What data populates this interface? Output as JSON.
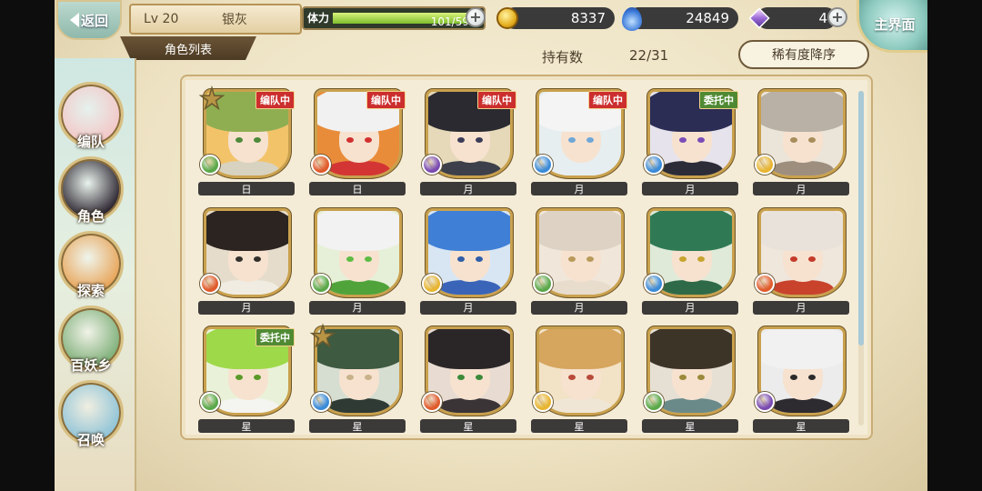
{
  "header": {
    "back_label": "返回",
    "level": "Lv 20",
    "player_name": "银灰",
    "stamina_label": "体力",
    "stamina_value": "101/59",
    "stamina_fraction": 1.0,
    "gold": "8337",
    "spirit": "24849",
    "gems": "4",
    "home_label": "主界面"
  },
  "section_title": "角色列表",
  "owned": {
    "label": "持有数",
    "value": "22/31"
  },
  "sort_label": "稀有度降序",
  "nav": [
    {
      "label": "编队",
      "icon": "formation-icon",
      "color": "#f2c8c8"
    },
    {
      "label": "角色",
      "icon": "character-icon",
      "color": "#2b2530"
    },
    {
      "label": "探索",
      "icon": "explore-icon",
      "color": "#e8a55a"
    },
    {
      "label": "百妖乡",
      "icon": "village-icon",
      "color": "#7fb07a"
    },
    {
      "label": "召唤",
      "icon": "summon-icon",
      "color": "#8fc4d8"
    }
  ],
  "characters": [
    {
      "name": "日",
      "badge": "编队中",
      "badge_type": "formation",
      "star": true,
      "element": "wind",
      "hair": "#8fae52",
      "eye": "#4e8a3a",
      "body": "#d8d2c0",
      "bg": "#f3c36a"
    },
    {
      "name": "日",
      "badge": "编队中",
      "badge_type": "formation",
      "star": false,
      "element": "fire",
      "hair": "#f1f1f1",
      "eye": "#d23030",
      "body": "#d33535",
      "bg": "#e98c3a"
    },
    {
      "name": "月",
      "badge": "编队中",
      "badge_type": "formation",
      "star": false,
      "element": "dark",
      "hair": "#2a2a30",
      "eye": "#3b3b58",
      "body": "#3d3f4a",
      "bg": "#e6d9b9"
    },
    {
      "name": "月",
      "badge": "编队中",
      "badge_type": "formation",
      "star": false,
      "element": "water",
      "hair": "#f4f4f4",
      "eye": "#6fa6d8",
      "body": "#e7eef2",
      "bg": "#e6eef0"
    },
    {
      "name": "月",
      "badge": "委托中",
      "badge_type": "entrust",
      "star": false,
      "element": "water",
      "hair": "#2b2d55",
      "eye": "#7b4bb8",
      "body": "#2c2c38",
      "bg": "#e6e3ec"
    },
    {
      "name": "月",
      "badge": "",
      "badge_type": "",
      "star": false,
      "element": "light",
      "hair": "#b9b0a6",
      "eye": "#a88d5c",
      "body": "#9d8e7e",
      "bg": "#ebe5d9"
    },
    {
      "name": "月",
      "badge": "",
      "badge_type": "",
      "star": false,
      "element": "fire",
      "hair": "#2b2420",
      "eye": "#33302c",
      "body": "#f0ece2",
      "bg": "#e6dccb"
    },
    {
      "name": "月",
      "badge": "",
      "badge_type": "",
      "star": false,
      "element": "wind",
      "hair": "#f2f2f2",
      "eye": "#5dbb43",
      "body": "#4fa33a",
      "bg": "#e6f0d8"
    },
    {
      "name": "月",
      "badge": "",
      "badge_type": "",
      "star": false,
      "element": "light",
      "hair": "#3f7fd6",
      "eye": "#2f5da8",
      "body": "#3a64b8",
      "bg": "#d8e6f4"
    },
    {
      "name": "月",
      "badge": "",
      "badge_type": "",
      "star": false,
      "element": "wind",
      "hair": "#ddd2c4",
      "eye": "#b89a5a",
      "body": "#e8dccc",
      "bg": "#f0e6da"
    },
    {
      "name": "月",
      "badge": "",
      "badge_type": "",
      "star": false,
      "element": "water",
      "hair": "#2f7a55",
      "eye": "#c8a32e",
      "body": "#2f6a48",
      "bg": "#dfead8"
    },
    {
      "name": "月",
      "badge": "",
      "badge_type": "",
      "star": false,
      "element": "fire",
      "hair": "#e8e2da",
      "eye": "#c43a2a",
      "body": "#c8422c",
      "bg": "#efe6dc"
    },
    {
      "name": "星",
      "badge": "委托中",
      "badge_type": "entrust",
      "star": false,
      "element": "wind",
      "hair": "#9ed94a",
      "eye": "#5a9a2a",
      "body": "#f4f4f0",
      "bg": "#e9f2d8"
    },
    {
      "name": "星",
      "badge": "",
      "badge_type": "",
      "star": true,
      "element": "water",
      "hair": "#3e5a40",
      "eye": "#c8b28a",
      "body": "#2f3a34",
      "bg": "#d6ded2"
    },
    {
      "name": "星",
      "badge": "",
      "badge_type": "",
      "star": false,
      "element": "fire",
      "hair": "#2a2628",
      "eye": "#3a8a3a",
      "body": "#3a3436",
      "bg": "#e8dcd2"
    },
    {
      "name": "星",
      "badge": "",
      "badge_type": "",
      "star": false,
      "element": "light",
      "hair": "#d6a55e",
      "eye": "#b84a3a",
      "body": "#efe6d6",
      "bg": "#f2e2c6"
    },
    {
      "name": "星",
      "badge": "",
      "badge_type": "",
      "star": false,
      "element": "wind",
      "hair": "#3d3428",
      "eye": "#9a8a3a",
      "body": "#6a8a8a",
      "bg": "#e6e0d4"
    },
    {
      "name": "星",
      "badge": "",
      "badge_type": "",
      "star": false,
      "element": "dark",
      "hair": "#f1f1f1",
      "eye": "#2a2a2a",
      "body": "#2d2a30",
      "bg": "#ececec"
    }
  ],
  "element_colors": {
    "wind": "#5aa84a",
    "fire": "#e05a2a",
    "dark": "#7a4ab0",
    "water": "#3a8ad8",
    "light": "#e8b530"
  }
}
